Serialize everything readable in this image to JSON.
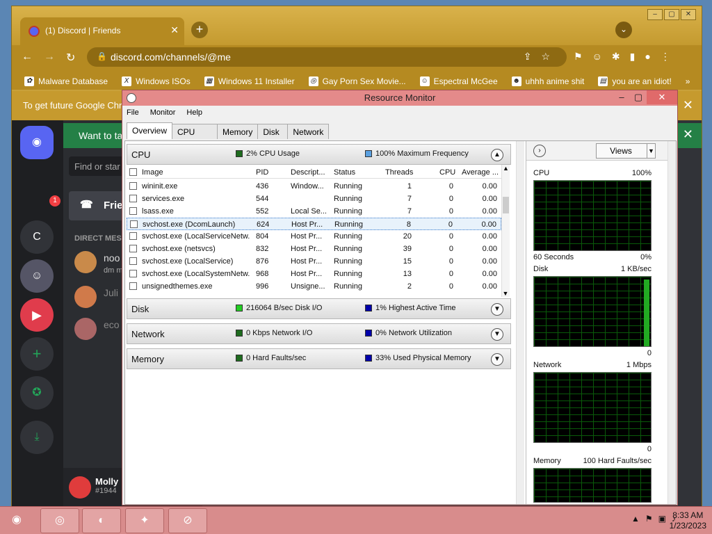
{
  "chrome": {
    "tab_title": "(1) Discord | Friends",
    "url": "discord.com/channels/@me",
    "bookmarks": [
      "Malware Database",
      "Windows ISOs",
      "Windows 11 Installer",
      "Gay Porn Sex Movie...",
      "Espectral McGee",
      "uhhh anime shit",
      "you are an idiot!"
    ],
    "infobar": "To get future Google Chr"
  },
  "discord": {
    "banner": "Want to ta",
    "find": "Find or star",
    "friends": "Frie",
    "dm_header": "DIRECT MES",
    "dms": [
      {
        "name": "noo",
        "sub": "dm m"
      },
      {
        "name": "Juli",
        "sub": ""
      },
      {
        "name": "eco",
        "sub": ""
      }
    ],
    "badge": "1",
    "server_letter": "C",
    "user": {
      "name": "Molly",
      "tag": "#1944"
    }
  },
  "rm": {
    "title": "Resource Monitor",
    "menu": [
      "File",
      "Monitor",
      "Help"
    ],
    "tabs": [
      "Overview",
      "CPU",
      "Memory",
      "Disk",
      "Network"
    ],
    "sections": {
      "cpu": {
        "name": "CPU",
        "m1": "2% CPU Usage",
        "m2": "100% Maximum Frequency",
        "c1": "#1e6b1e",
        "c2": "#5aa0e0"
      },
      "disk": {
        "name": "Disk",
        "m1": "216064 B/sec Disk I/O",
        "m2": "1% Highest Active Time",
        "c1": "#22cc22",
        "c2": "#0000aa"
      },
      "network": {
        "name": "Network",
        "m1": "0 Kbps Network I/O",
        "m2": "0% Network Utilization",
        "c1": "#1e6b1e",
        "c2": "#0000aa"
      },
      "memory": {
        "name": "Memory",
        "m1": "0 Hard Faults/sec",
        "m2": "33% Used Physical Memory",
        "c1": "#1e6b1e",
        "c2": "#0000aa"
      }
    },
    "columns": [
      "Image",
      "PID",
      "Descript...",
      "Status",
      "Threads",
      "CPU",
      "Average ..."
    ],
    "rows": [
      [
        "wininit.exe",
        "436",
        "Window...",
        "Running",
        "1",
        "0",
        "0.00"
      ],
      [
        "services.exe",
        "544",
        "",
        "Running",
        "7",
        "0",
        "0.00"
      ],
      [
        "lsass.exe",
        "552",
        "Local Se...",
        "Running",
        "7",
        "0",
        "0.00"
      ],
      [
        "svchost.exe (DcomLaunch)",
        "624",
        "Host Pr...",
        "Running",
        "8",
        "0",
        "0.00"
      ],
      [
        "svchost.exe (LocalServiceNetw...",
        "804",
        "Host Pr...",
        "Running",
        "20",
        "0",
        "0.00"
      ],
      [
        "svchost.exe (netsvcs)",
        "832",
        "Host Pr...",
        "Running",
        "39",
        "0",
        "0.00"
      ],
      [
        "svchost.exe (LocalService)",
        "876",
        "Host Pr...",
        "Running",
        "15",
        "0",
        "0.00"
      ],
      [
        "svchost.exe (LocalSystemNetw...",
        "968",
        "Host Pr...",
        "Running",
        "13",
        "0",
        "0.00"
      ],
      [
        "unsignedthemes.exe",
        "996",
        "Unsigne...",
        "Running",
        "2",
        "0",
        "0.00"
      ]
    ],
    "views": "Views",
    "graphs": [
      {
        "label": "CPU",
        "right": "100%",
        "foot_left": "60 Seconds",
        "foot_right": "0%"
      },
      {
        "label": "Disk",
        "right": "1 KB/sec",
        "foot_left": "",
        "foot_right": "0"
      },
      {
        "label": "Network",
        "right": "1 Mbps",
        "foot_left": "",
        "foot_right": "0"
      },
      {
        "label": "Memory",
        "right": "100 Hard Faults/sec",
        "foot_left": "",
        "foot_right": ""
      }
    ]
  },
  "taskbar": {
    "time": "8:33 AM",
    "date": "1/23/2023"
  }
}
